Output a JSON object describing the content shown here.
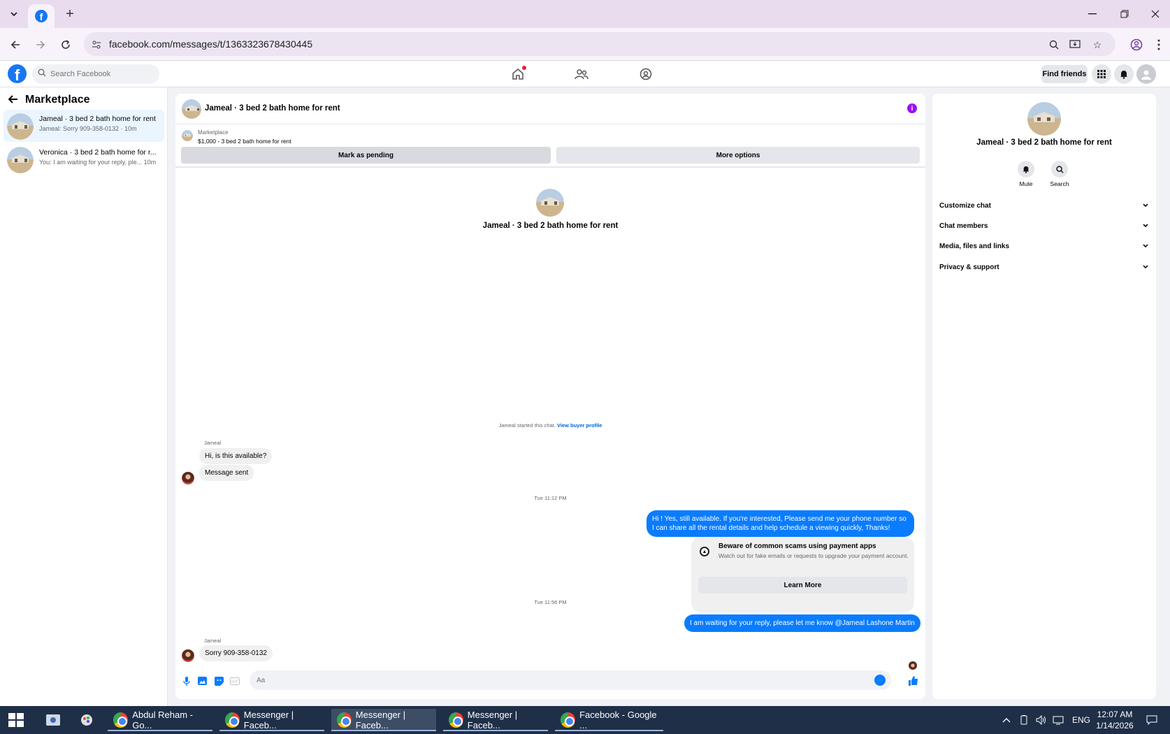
{
  "browser": {
    "url": "facebook.com/messages/t/1363323678430445"
  },
  "fbnav": {
    "search_placeholder": "Search Facebook",
    "find_friends": "Find friends"
  },
  "sidebar": {
    "title": "Marketplace",
    "conversations": [
      {
        "name": "Jameal · 3 bed 2 bath home for rent",
        "preview": "Jameal: Sorry 909-358-0132 · 10m",
        "active": true
      },
      {
        "name": "Veronica · 3 bed 2 bath home for r...",
        "preview": "You: I am waiting for your reply, ple...   10m",
        "active": false
      }
    ]
  },
  "chat": {
    "header_title": "Jameal · 3 bed 2 bath home for rent",
    "listing_source": "Marketplace",
    "listing_title": "$1,000 - 3 bed 2 bath home for rent",
    "mark_pending": "Mark as pending",
    "more_options": "More options",
    "center_title": "Jameal · 3 bed 2 bath home for rent",
    "started_text": "Jameal started this chat.",
    "view_buyer_profile": "View buyer profile",
    "messages": {
      "sender1": "Jameal",
      "msg1": "Hi, is this available?",
      "msg2": "Message sent",
      "time1": "Tue 11:12 PM",
      "out1": "Hi ! Yes, still available. If you're interested, Please send me your phone number so I can share all the rental details and help schedule a viewing quickly, Thanks!",
      "scam_title": "Beware of common scams using payment apps",
      "scam_text": "Watch out for fake emails or requests to upgrade your payment account.",
      "learn_more": "Learn More",
      "time2": "Tue 11:56 PM",
      "out2": "I am waiting for your reply, please let me know @Jameal Lashone Martin",
      "sender2": "Jameal",
      "msg3": "Sorry 909-358-0132"
    },
    "composer_value": "Aa"
  },
  "rpanel": {
    "title": "Jameal · 3 bed 2 bath home for rent",
    "mute": "Mute",
    "search": "Search",
    "sections": [
      "Customize chat",
      "Chat members",
      "Media, files and links",
      "Privacy & support"
    ]
  },
  "taskbar": {
    "apps": [
      "Abdul Reham - Go...",
      "Messenger | Faceb...",
      "Messenger | Faceb...",
      "Messenger | Faceb...",
      "Facebook - Google ..."
    ],
    "lang": "ENG",
    "time": "12:07 AM",
    "date": "1/14/2026"
  },
  "colors": {
    "accent": "#0a7cff",
    "fb_blue": "#1877f2"
  }
}
